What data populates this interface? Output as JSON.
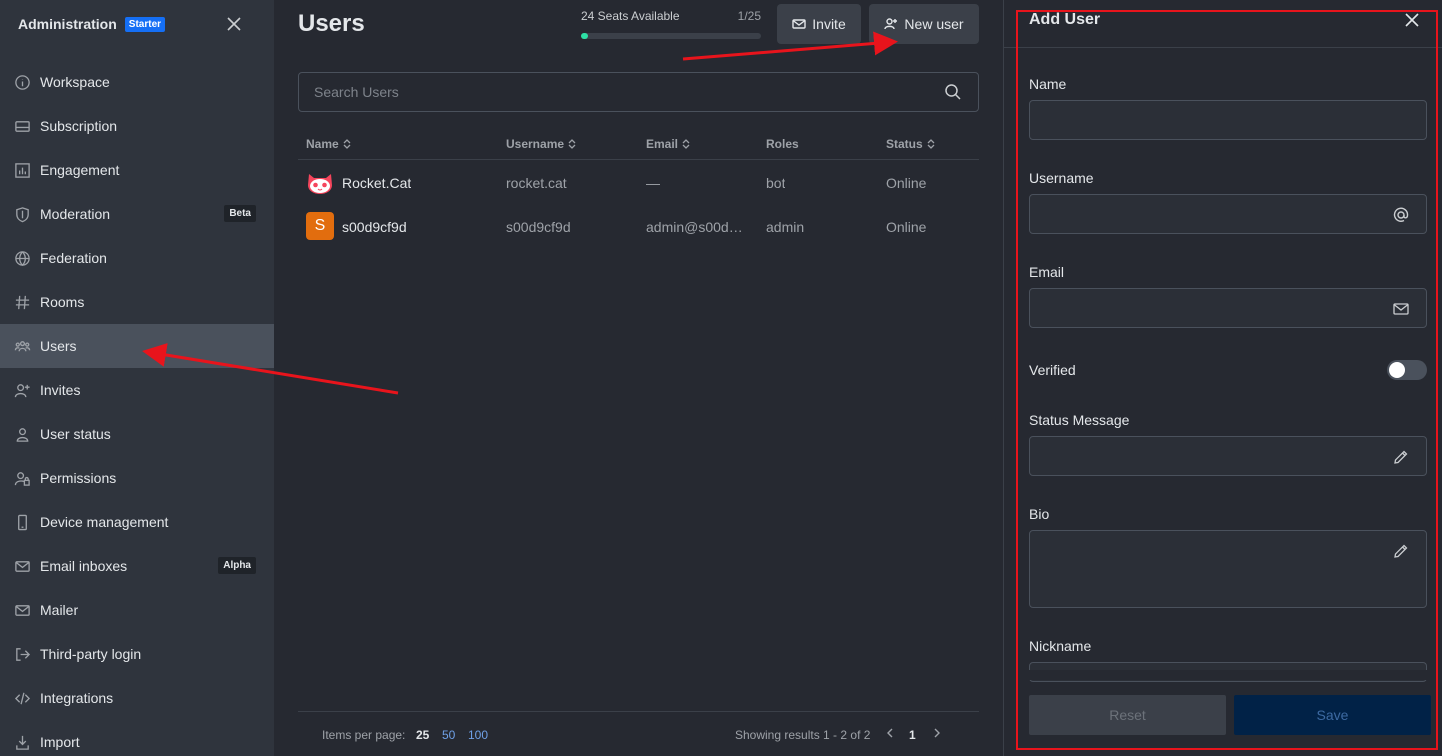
{
  "sidebar": {
    "title": "Administration",
    "badge": "Starter",
    "items": [
      {
        "label": "Workspace",
        "icon": "info-icon"
      },
      {
        "label": "Subscription",
        "icon": "card-icon"
      },
      {
        "label": "Engagement",
        "icon": "bar-chart-icon"
      },
      {
        "label": "Moderation",
        "icon": "shield-icon",
        "tag": "Beta"
      },
      {
        "label": "Federation",
        "icon": "globe-icon"
      },
      {
        "label": "Rooms",
        "icon": "hashtag-icon"
      },
      {
        "label": "Users",
        "icon": "team-icon",
        "active": true
      },
      {
        "label": "Invites",
        "icon": "user-plus-icon"
      },
      {
        "label": "User status",
        "icon": "user-icon"
      },
      {
        "label": "Permissions",
        "icon": "user-lock-icon"
      },
      {
        "label": "Device management",
        "icon": "mobile-icon"
      },
      {
        "label": "Email inboxes",
        "icon": "mail-icon",
        "tag": "Alpha"
      },
      {
        "label": "Mailer",
        "icon": "mail-icon"
      },
      {
        "label": "Third-party login",
        "icon": "login-icon"
      },
      {
        "label": "Integrations",
        "icon": "code-icon"
      },
      {
        "label": "Import",
        "icon": "import-icon"
      }
    ]
  },
  "main": {
    "title": "Users",
    "seats": {
      "label": "24 Seats Available",
      "count": "1/25",
      "used_fraction": 0.04
    },
    "invite_label": "Invite",
    "new_user_label": "New user",
    "search_placeholder": "Search Users",
    "columns": [
      "Name",
      "Username",
      "Email",
      "Roles",
      "Status"
    ],
    "rows": [
      {
        "name": "Rocket.Cat",
        "username": "rocket.cat",
        "email": "—",
        "roles": "bot",
        "status": "Online",
        "avatar": "rocket-cat-icon"
      },
      {
        "name": "s00d9cf9d",
        "username": "s00d9cf9d",
        "email": "admin@s00d…",
        "roles": "admin",
        "status": "Online",
        "avatar_letter": "S"
      }
    ],
    "pagination": {
      "items_per_page_label": "Items per page:",
      "options": [
        "25",
        "50",
        "100"
      ],
      "selected": "25",
      "results": "Showing results 1 - 2 of 2",
      "page": "1"
    }
  },
  "panel": {
    "title": "Add User",
    "fields": {
      "name": "Name",
      "username": "Username",
      "email": "Email",
      "verified": "Verified",
      "status_message": "Status Message",
      "bio": "Bio",
      "nickname": "Nickname"
    },
    "reset_label": "Reset",
    "save_label": "Save"
  },
  "colors": {
    "annotation": "#e8141c",
    "accent": "#156ff5",
    "seat_fill": "#2de0a5"
  }
}
